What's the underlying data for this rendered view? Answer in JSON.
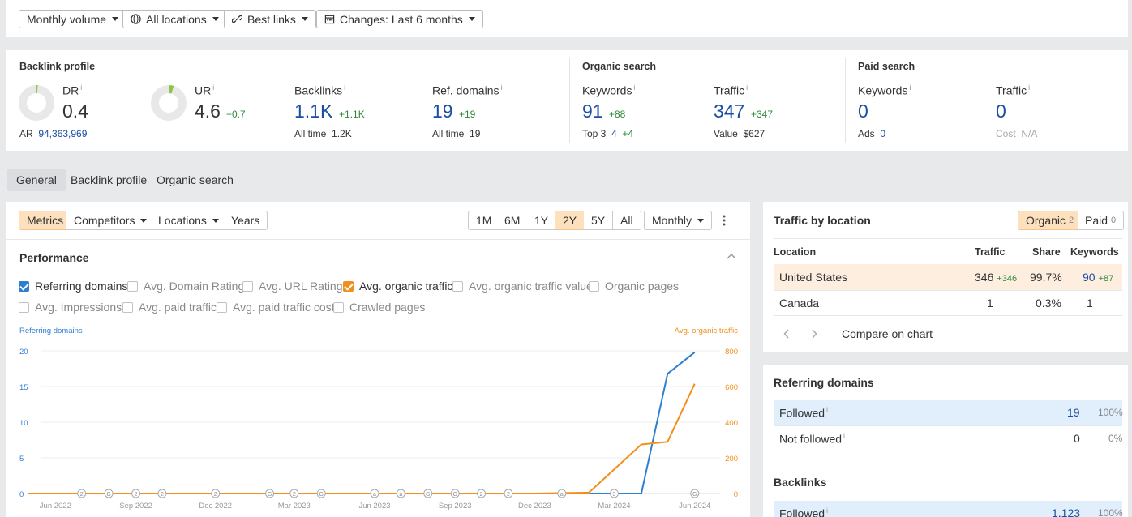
{
  "filters": {
    "volume": "Monthly volume",
    "locations": "All locations",
    "links": "Best links",
    "changes": "Changes: Last 6 months"
  },
  "overview": {
    "backlink_profile": {
      "title": "Backlink profile",
      "dr": {
        "label": "DR",
        "value": "0.4",
        "gauge_fraction": 0.004
      },
      "ar": {
        "label": "AR",
        "value": "94,363,969"
      },
      "ur": {
        "label": "UR",
        "value": "4.6",
        "delta": "+0.7",
        "gauge_fraction": 0.046
      },
      "backlinks": {
        "label": "Backlinks",
        "value": "1.1K",
        "delta": "+1.1K",
        "sub_label": "All time",
        "sub_value": "1.2K"
      },
      "ref_domains": {
        "label": "Ref. domains",
        "value": "19",
        "delta": "+19",
        "sub_label": "All time",
        "sub_value": "19"
      }
    },
    "organic_search": {
      "title": "Organic search",
      "keywords": {
        "label": "Keywords",
        "value": "91",
        "delta": "+88",
        "sub_label": "Top 3",
        "sub_value": "4",
        "sub_delta": "+4"
      },
      "traffic": {
        "label": "Traffic",
        "value": "347",
        "delta": "+347",
        "sub_label": "Value",
        "sub_value": "$627"
      }
    },
    "paid_search": {
      "title": "Paid search",
      "keywords": {
        "label": "Keywords",
        "value": "0",
        "sub_label": "Ads",
        "sub_value": "0"
      },
      "traffic": {
        "label": "Traffic",
        "value": "0",
        "sub_label": "Cost",
        "sub_value": "N/A"
      }
    }
  },
  "tabs": [
    "General",
    "Backlink profile",
    "Organic search"
  ],
  "chart_toolbar": {
    "metrics": "Metrics",
    "competitors": "Competitors",
    "locations": "Locations",
    "years": "Years",
    "ranges": [
      "1M",
      "6M",
      "1Y",
      "2Y",
      "5Y",
      "All"
    ],
    "active_range": "2Y",
    "interval": "Monthly"
  },
  "performance": {
    "title": "Performance",
    "checkboxes": [
      {
        "label": "Referring domains",
        "checked": true,
        "color": "#2f7fd1"
      },
      {
        "label": "Avg. Domain Rating",
        "checked": false
      },
      {
        "label": "Avg. URL Rating",
        "checked": false
      },
      {
        "label": "Avg. organic traffic",
        "checked": true,
        "color": "#f28f1b"
      },
      {
        "label": "Avg. organic traffic value",
        "checked": false
      },
      {
        "label": "Organic pages",
        "checked": false
      },
      {
        "label": "Avg. Impressions",
        "checked": false
      },
      {
        "label": "Avg. paid traffic",
        "checked": false
      },
      {
        "label": "Avg. paid traffic cost",
        "checked": false
      },
      {
        "label": "Crawled pages",
        "checked": false
      }
    ]
  },
  "chart_data": {
    "type": "line",
    "left_axis_label": "Referring domains",
    "right_axis_label": "Avg. organic traffic",
    "left_ticks": [
      "0",
      "5",
      "10",
      "15",
      "20"
    ],
    "right_ticks": [
      "0",
      "200",
      "400",
      "600",
      "800"
    ],
    "left_ylim": [
      0,
      20
    ],
    "right_ylim": [
      0,
      800
    ],
    "x_tick_labels": [
      "Jun 2022",
      "Sep 2022",
      "Dec 2022",
      "Mar 2023",
      "Jun 2023",
      "Sep 2023",
      "Dec 2023",
      "Mar 2024",
      "Jun 2024"
    ],
    "x_range": [
      "2022-05-15",
      "2024-06-30"
    ],
    "series": [
      {
        "name": "Referring domains",
        "axis": "left",
        "color": "#2f7fd1",
        "x": [
          "2022-05-01",
          "2024-03-01",
          "2024-04-01",
          "2024-05-01",
          "2024-06-01"
        ],
        "values": [
          0,
          0,
          0,
          16.8,
          19.8
        ]
      },
      {
        "name": "Avg. organic traffic",
        "axis": "right",
        "color": "#f28f1b",
        "x": [
          "2022-05-01",
          "2023-12-01",
          "2024-02-01",
          "2024-04-01",
          "2024-05-01",
          "2024-06-01"
        ],
        "values": [
          0,
          0,
          5,
          275,
          290,
          615
        ]
      }
    ],
    "markers": [
      {
        "x": "2022-07-01",
        "text": "2"
      },
      {
        "x": "2022-08-01",
        "text": "G"
      },
      {
        "x": "2022-09-01",
        "text": "2"
      },
      {
        "x": "2022-10-01",
        "text": "2"
      },
      {
        "x": "2022-12-01",
        "text": "2"
      },
      {
        "x": "2023-02-01",
        "text": "G"
      },
      {
        "x": "2023-03-01",
        "text": "2"
      },
      {
        "x": "2023-04-01",
        "text": "G"
      },
      {
        "x": "2023-06-01",
        "text": "a"
      },
      {
        "x": "2023-07-01",
        "text": "a"
      },
      {
        "x": "2023-08-01",
        "text": "G"
      },
      {
        "x": "2023-09-01",
        "text": "G"
      },
      {
        "x": "2023-10-01",
        "text": "2"
      },
      {
        "x": "2023-11-01",
        "text": "2"
      },
      {
        "x": "2024-01-01",
        "text": "a"
      },
      {
        "x": "2024-03-01",
        "text": "3"
      },
      {
        "x": "2024-06-01",
        "text": "G"
      }
    ]
  },
  "traffic_by_location": {
    "title": "Traffic by location",
    "toggle_organic": "Organic",
    "toggle_organic_count": "2",
    "toggle_paid": "Paid",
    "toggle_paid_count": "0",
    "headers": {
      "location": "Location",
      "traffic": "Traffic",
      "share": "Share",
      "keywords": "Keywords"
    },
    "rows": [
      {
        "location": "United States",
        "traffic": "346",
        "traffic_delta": "+346",
        "share": "99.7%",
        "keywords": "90",
        "keywords_delta": "+87"
      },
      {
        "location": "Canada",
        "traffic": "1",
        "traffic_delta": "",
        "share": "0.3%",
        "keywords": "1",
        "keywords_delta": ""
      }
    ],
    "compare": "Compare on chart"
  },
  "referring_domains": {
    "title": "Referring domains",
    "rows": [
      {
        "label": "Followed",
        "value": "19",
        "pct": "100%"
      },
      {
        "label": "Not followed",
        "value": "0",
        "pct": "0%"
      }
    ]
  },
  "backlinks": {
    "title": "Backlinks",
    "rows": [
      {
        "label": "Followed",
        "value": "1,123",
        "pct": "100%"
      }
    ]
  },
  "colors": {
    "accent_blue": "#1a4fa1",
    "positive": "#2e8a3a",
    "series_blue": "#2f7fd1",
    "series_orange": "#f28f1b",
    "highlight": "#fdeee0"
  }
}
